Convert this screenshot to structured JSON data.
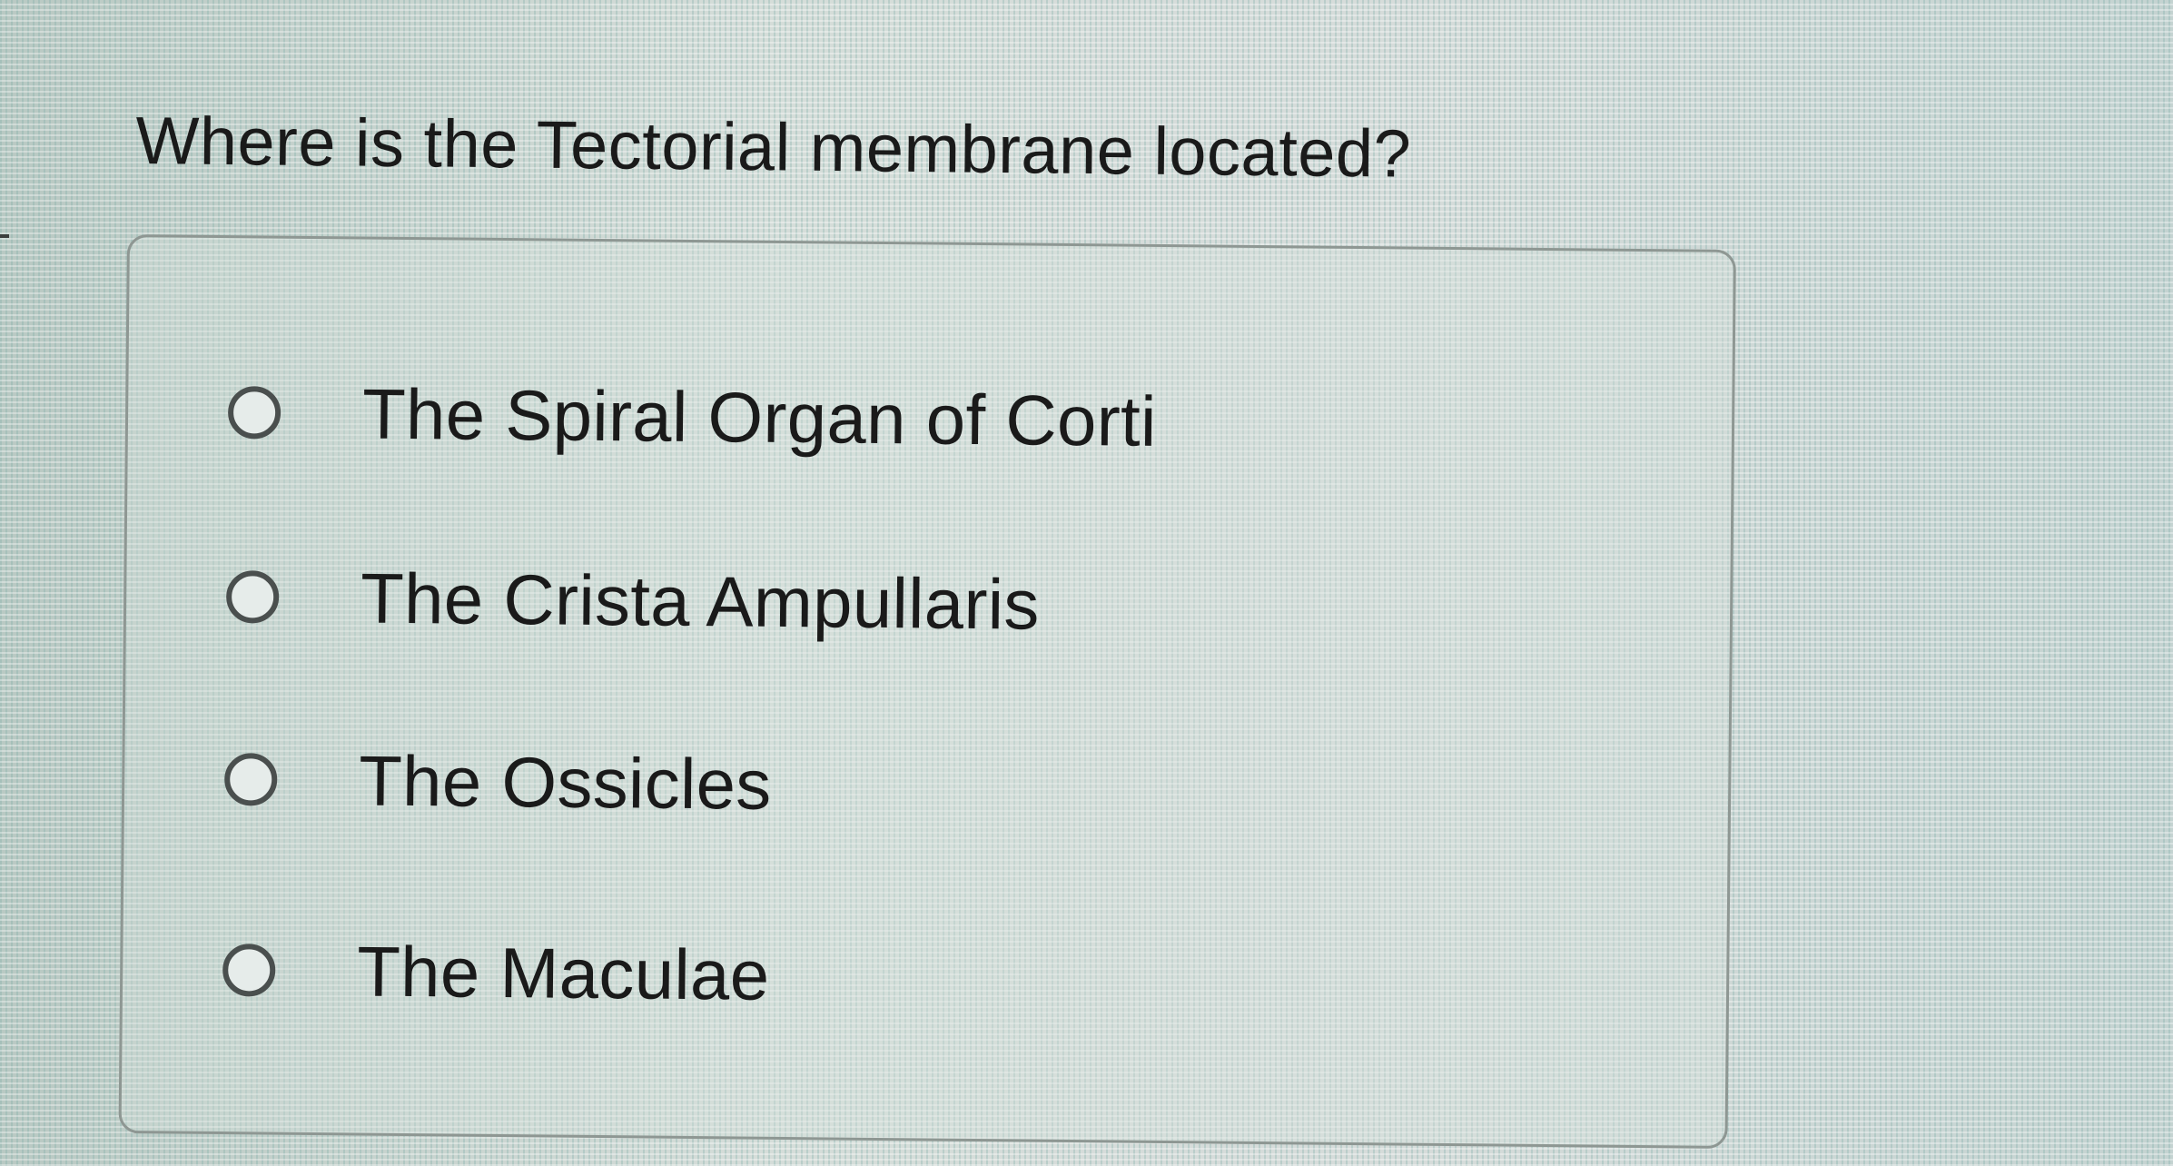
{
  "question": {
    "text": "Where is the Tectorial membrane located?"
  },
  "options": [
    {
      "label": "The Spiral Organ of Corti",
      "selected": false
    },
    {
      "label": "The Crista Ampullaris",
      "selected": false
    },
    {
      "label": "The Ossicles",
      "selected": false
    },
    {
      "label": "The Maculae",
      "selected": false
    }
  ]
}
